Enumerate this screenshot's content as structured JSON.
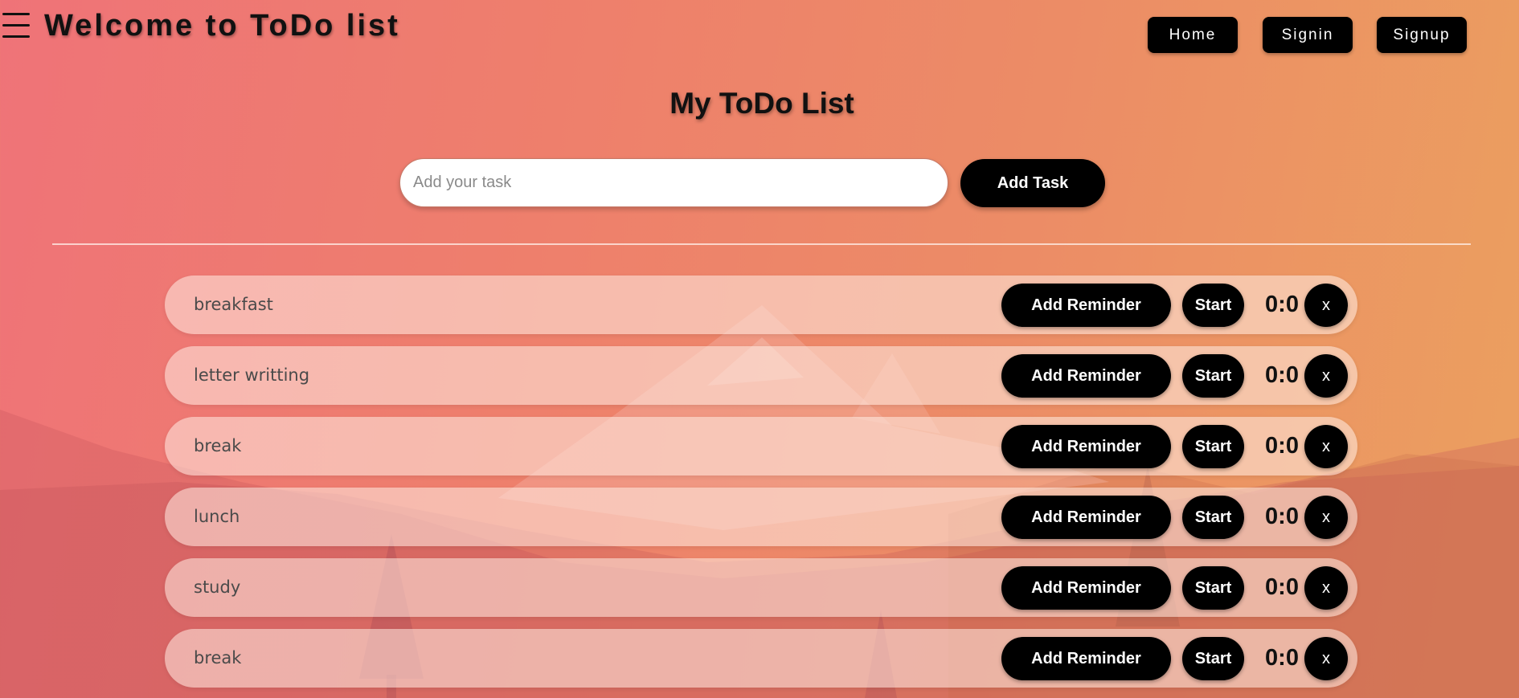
{
  "header": {
    "title": "Welcome to ToDo list",
    "menu_icon": "hamburger-menu-icon",
    "nav": {
      "home": "Home",
      "signin": "Signin",
      "signup": "Signup"
    }
  },
  "main": {
    "heading": "My ToDo List",
    "input": {
      "value": "",
      "placeholder": "Add your task"
    },
    "add_button": "Add Task"
  },
  "tasks": [
    {
      "name": "breakfast",
      "reminder": "Add Reminder",
      "start": "Start",
      "timer": "0:0",
      "delete": "x"
    },
    {
      "name": "letter writting",
      "reminder": "Add Reminder",
      "start": "Start",
      "timer": "0:0",
      "delete": "x"
    },
    {
      "name": "break",
      "reminder": "Add Reminder",
      "start": "Start",
      "timer": "0:0",
      "delete": "x"
    },
    {
      "name": "lunch",
      "reminder": "Add Reminder",
      "start": "Start",
      "timer": "0:0",
      "delete": "x"
    },
    {
      "name": "study",
      "reminder": "Add Reminder",
      "start": "Start",
      "timer": "0:0",
      "delete": "x"
    },
    {
      "name": "break",
      "reminder": "Add Reminder",
      "start": "Start",
      "timer": "0:0",
      "delete": "x"
    }
  ],
  "colors": {
    "background_start": "#ef7378",
    "background_end": "#eba05f",
    "button": "#000000",
    "button_text": "#ffffff"
  }
}
